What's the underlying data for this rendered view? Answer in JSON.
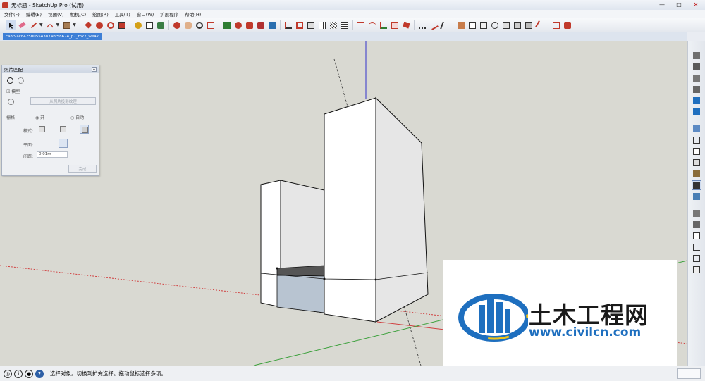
{
  "window": {
    "title": "无标题 - SketchUp Pro (试用)",
    "controls": [
      "—",
      "□",
      "✕"
    ]
  },
  "menu": [
    "文件(F)",
    "编辑(E)",
    "视图(V)",
    "相机(C)",
    "绘图(R)",
    "工具(T)",
    "窗口(W)",
    "扩展程序",
    "帮助(H)"
  ],
  "scene_tab": "ca8f9ac8425005543874bf58674_p7_mk7_we47",
  "photo_panel": {
    "title": "照片匹配",
    "close": "x",
    "model_checkbox": "模型",
    "project_texture_button": "从照片投影纹理",
    "edges_label": "栅格",
    "radio_on": "开",
    "radio_auto": "自动",
    "style_label": "样式:",
    "plane_label": "平面:",
    "spacing_label": "间距:",
    "spacing_value": "0.01m",
    "done_button": "完成"
  },
  "status": {
    "message": "选择对象。切换到扩充选择。拖动鼠标选择多项。",
    "help_icon": "?"
  },
  "watermark": {
    "brand": "土木工程网",
    "url": "www.civilcn.com"
  },
  "colors": {
    "sky": "#d9d9d2",
    "axis_red": "#d04040",
    "axis_green": "#3aa03a",
    "axis_blue": "#3333cc",
    "face_white": "#ffffff",
    "face_shaded": "#e6e6e6",
    "face_blue": "#b8c4d1",
    "watermark_blue": "#1e6fbf"
  }
}
